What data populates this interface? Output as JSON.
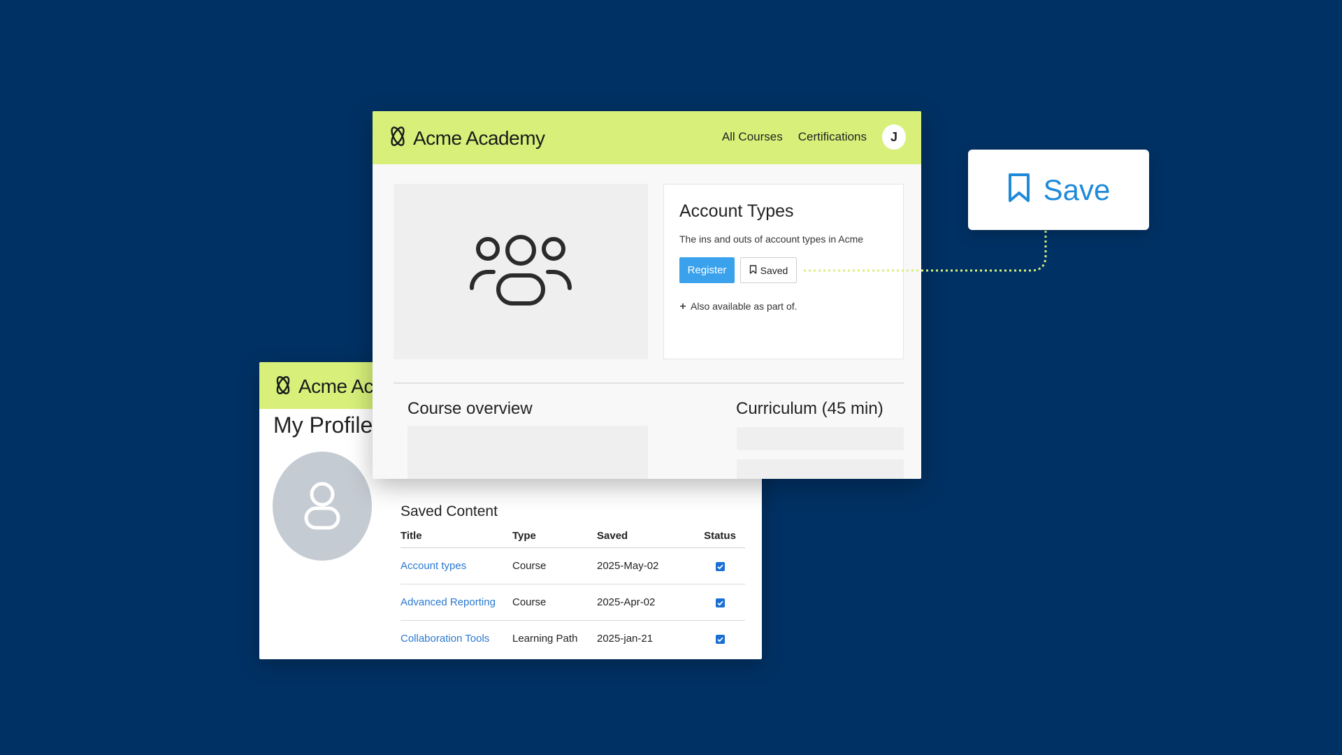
{
  "brand": {
    "name": "Acme Academy"
  },
  "course_page": {
    "nav": {
      "all_courses": "All Courses",
      "certifications": "Certifications",
      "user_initial": "J"
    },
    "course": {
      "title": "Account Types",
      "description": "The ins and outs of account types in Acme",
      "register_label": "Register",
      "saved_label": "Saved",
      "also_available": "Also available as part of."
    },
    "sections": {
      "overview": "Course overview",
      "curriculum": "Curriculum (45 min)"
    }
  },
  "profile_page": {
    "brand_visible": "Acme Acac",
    "title": "My Profile",
    "saved_content": {
      "heading": "Saved Content",
      "columns": [
        "Title",
        "Type",
        "Saved",
        "Status"
      ],
      "rows": [
        {
          "title": "Account types",
          "type": "Course",
          "saved": "2025-May-02",
          "status": true
        },
        {
          "title": "Advanced Reporting",
          "type": "Course",
          "saved": "2025-Apr-02",
          "status": true
        },
        {
          "title": "Collaboration Tools",
          "type": "Learning Path",
          "saved": "2025-jan-21",
          "status": true
        }
      ]
    }
  },
  "callout": {
    "label": "Save",
    "icon": "bookmark-icon"
  },
  "colors": {
    "background": "#003164",
    "header": "#d8f07a",
    "accent_blue": "#3aa1ec",
    "link_blue": "#2a78d0",
    "connector": "#d8f07a"
  }
}
